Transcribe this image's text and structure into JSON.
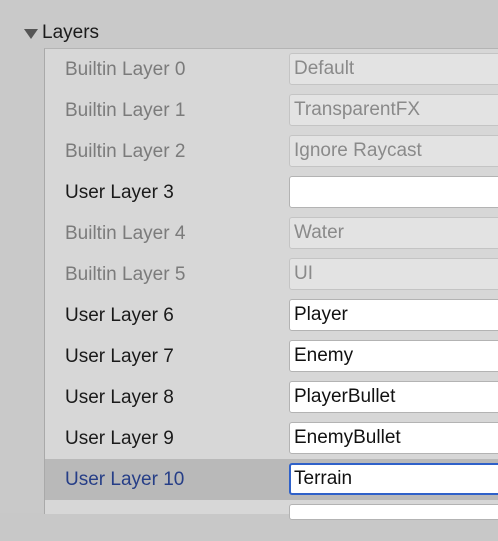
{
  "section": {
    "title": "Layers"
  },
  "layers": [
    {
      "label": "Builtin Layer 0",
      "value": "Default",
      "builtin": true,
      "selected": false
    },
    {
      "label": "Builtin Layer 1",
      "value": "TransparentFX",
      "builtin": true,
      "selected": false
    },
    {
      "label": "Builtin Layer 2",
      "value": "Ignore Raycast",
      "builtin": true,
      "selected": false
    },
    {
      "label": "User Layer 3",
      "value": "",
      "builtin": false,
      "selected": false
    },
    {
      "label": "Builtin Layer 4",
      "value": "Water",
      "builtin": true,
      "selected": false
    },
    {
      "label": "Builtin Layer 5",
      "value": "UI",
      "builtin": true,
      "selected": false
    },
    {
      "label": "User Layer 6",
      "value": "Player",
      "builtin": false,
      "selected": false
    },
    {
      "label": "User Layer 7",
      "value": "Enemy",
      "builtin": false,
      "selected": false
    },
    {
      "label": "User Layer 8",
      "value": "PlayerBullet",
      "builtin": false,
      "selected": false
    },
    {
      "label": "User Layer 9",
      "value": "EnemyBullet",
      "builtin": false,
      "selected": false
    },
    {
      "label": "User Layer 10",
      "value": "Terrain",
      "builtin": false,
      "selected": true
    }
  ],
  "colors": {
    "background": "#c9c9c9",
    "table_background": "#d7d7d7",
    "builtin_text": "#7b7b7b",
    "user_text": "#1a1a1a",
    "selected_row": "#b9b9b9",
    "selected_text": "#263e87",
    "focus_border": "#2f61c9"
  },
  "icons": {
    "foldout": "triangle-down-icon"
  }
}
